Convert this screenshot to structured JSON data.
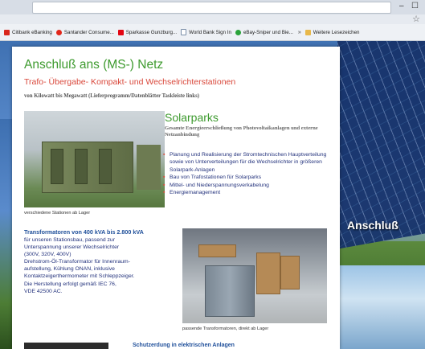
{
  "browser": {
    "bookmarks": [
      {
        "label": "Citibank eBanking",
        "color": "#d9261c"
      },
      {
        "label": "Santander Consume...",
        "color": "#e2261a"
      },
      {
        "label": "Sparkasse Gunzburg...",
        "color": "#e30613"
      },
      {
        "label": "World Bank Sign In",
        "color": "#7a8ea8"
      },
      {
        "label": "eBay-Sniper und Bie...",
        "color": "#2aa33a"
      },
      {
        "label": "Weitere Lesezeichen",
        "color": "#e8b84a"
      }
    ],
    "window_controls": [
      "–",
      "☐"
    ]
  },
  "page": {
    "title": "Anschluß ans (MS-) Netz",
    "subtitle": "Trafo- Übergabe- Kompakt- und Wechselrichterstationen",
    "range_line": "von Kilowatt bis Megawatt (Lieferprogramm/Datenblätter Taskleiste links)",
    "image1_caption": "verschiedene Stationen ab Lager",
    "solar": {
      "title": "Solarparks",
      "subtitle": "Gesamte Energieerschließung von Photovoltaikanlagen und externe Netzanbindung",
      "bullets": [
        "Planung und Realisierung der Stromtechnischen Hauptverteilung sowie von Unterverteilungen für die Wechselrichter in größeren Solarpark-Anlagen",
        "Bau von Trafostationen für Solarparks",
        "Mittel- und Niederspannungsverkabelung",
        "Energiemanagement"
      ]
    },
    "trafo": {
      "heading": "Transformatoren von 400 kVA bis 2.800 kVA",
      "lines": [
        "für unseren Stationsbau, passend zur",
        "Unterspannung unserer Wechselrichter",
        "(300V, 320V, 400V)",
        "Drehstrom-Öl-Transformator für Innenraum-",
        "aufstellung, Kühlung ONAN, inklusive",
        "Kontaktzeigerthermometer mit Schleppzeiger.",
        "Die Herstellung erfolgt gemäß IEC 76,",
        "VDE 42500 AC."
      ]
    },
    "image2_caption": "passende Transformatoren, direkt ab Lager",
    "bottom_heading": "Schutzerdung in elektrischen Anlagen"
  },
  "background": {
    "caption": "Anschluß"
  }
}
